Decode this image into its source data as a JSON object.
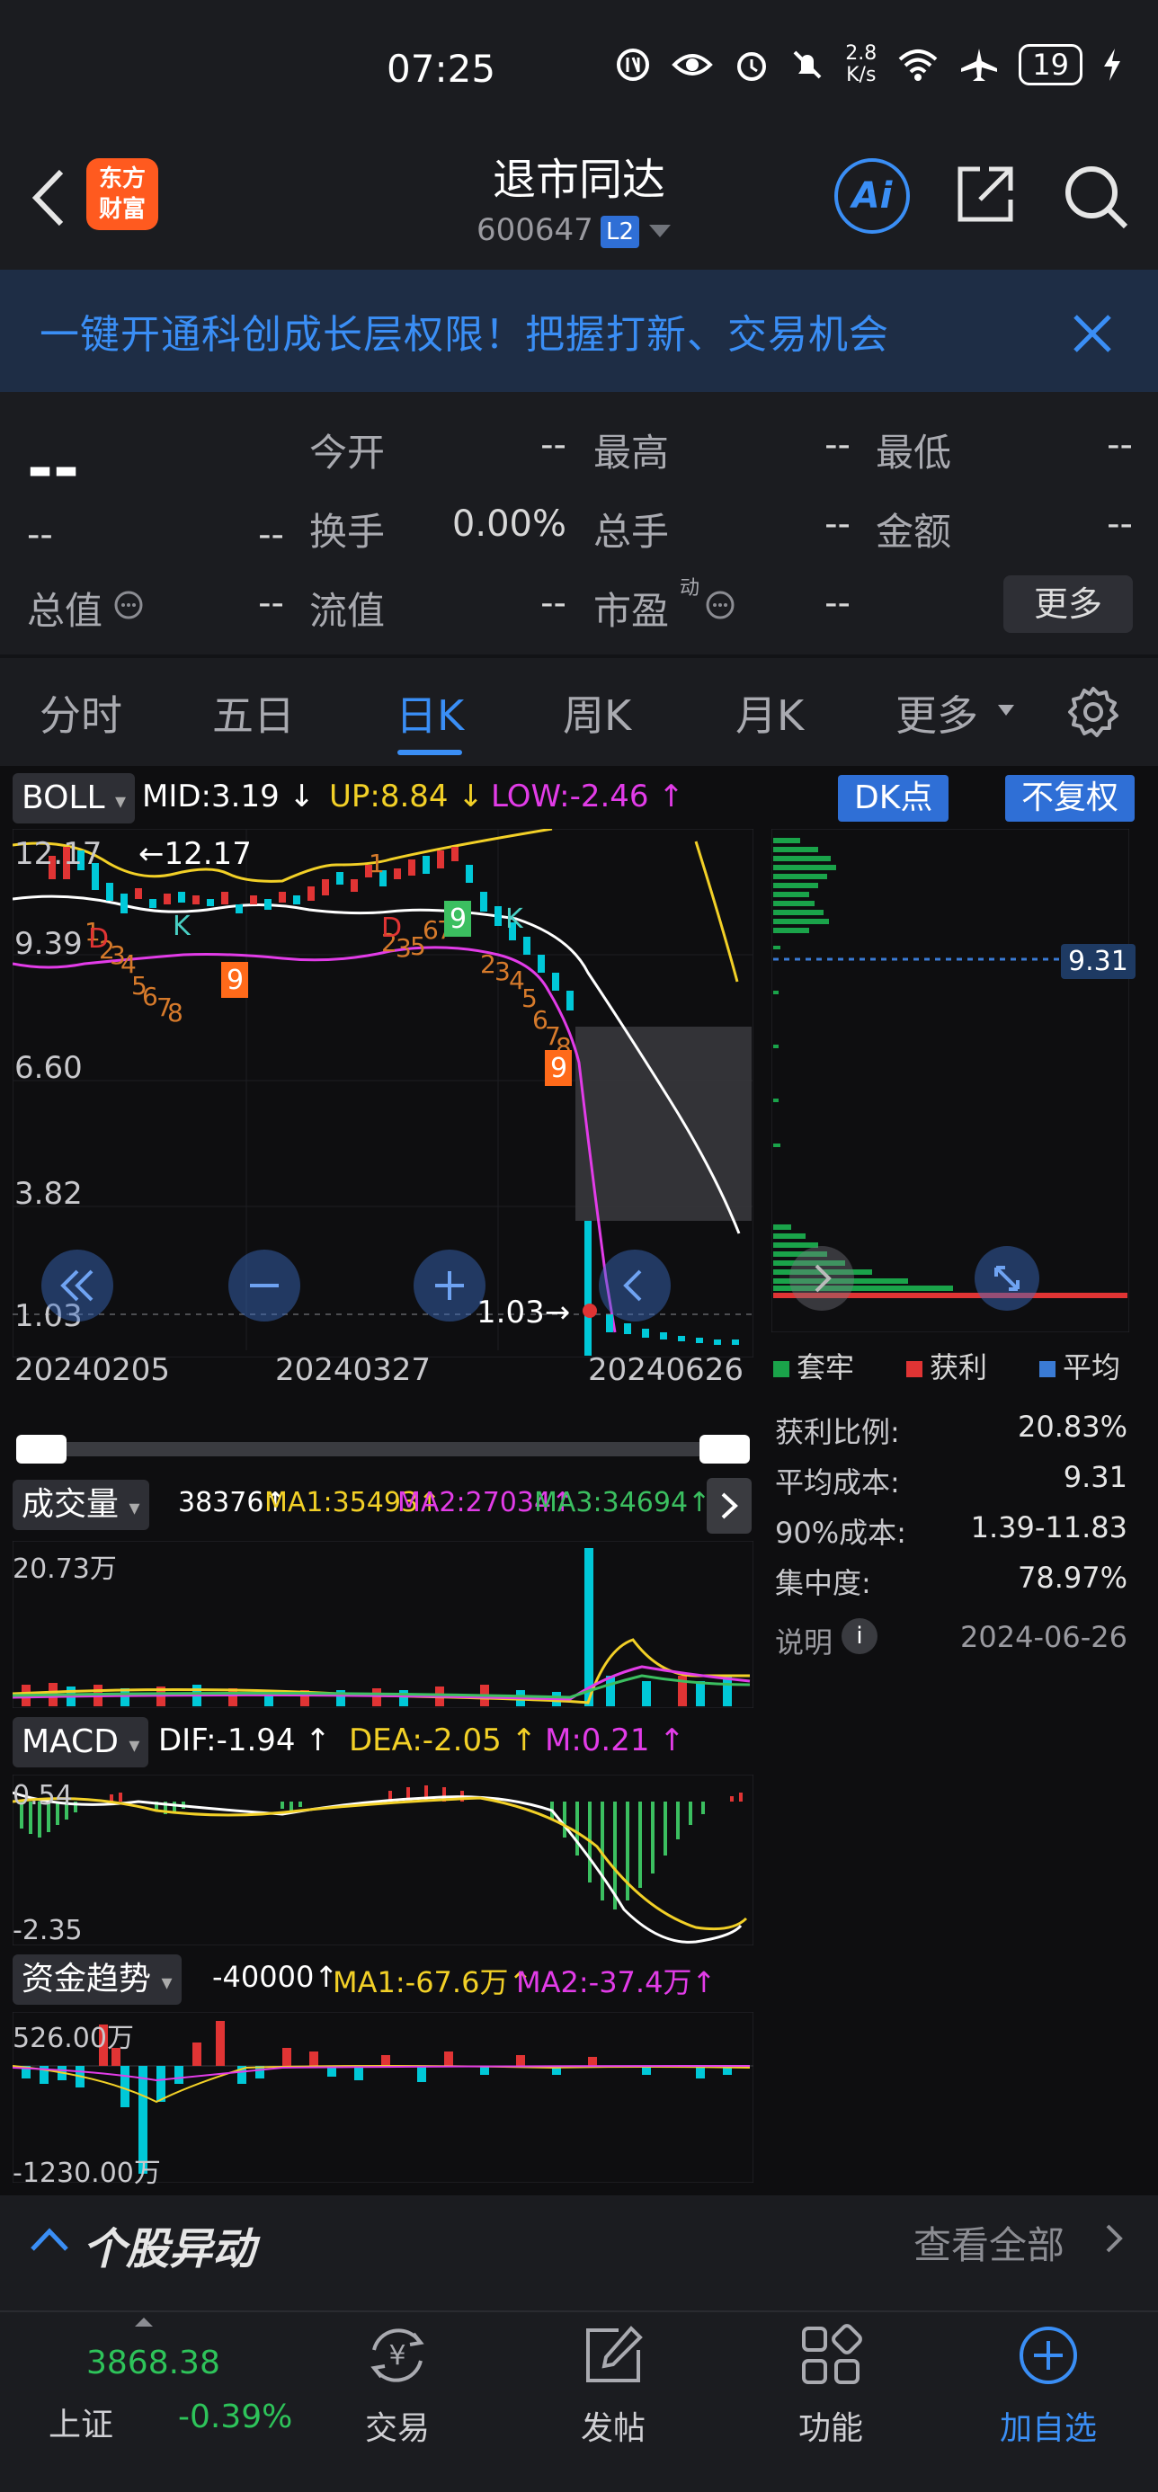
{
  "status": {
    "time": "07:25",
    "net_speed_top": "2.8",
    "net_speed_bottom": "K/s",
    "battery": "19"
  },
  "header": {
    "title": "退市同达",
    "code": "600647",
    "level_badge": "L2",
    "logo_text_top": "东方",
    "logo_text_bottom": "财富",
    "ai_label": "Ai"
  },
  "banner": {
    "text": "一键开通科创成长层权限！把握打新、交易机会"
  },
  "quote": {
    "price": "--",
    "change": "--",
    "change_pct": "--",
    "fields": [
      {
        "label": "今开",
        "value": "--"
      },
      {
        "label": "最高",
        "value": "--"
      },
      {
        "label": "最低",
        "value": "--"
      },
      {
        "label": "换手",
        "value": "0.00%"
      },
      {
        "label": "总手",
        "value": "--"
      },
      {
        "label": "金额",
        "value": "--"
      },
      {
        "label": "总值",
        "value": "--"
      },
      {
        "label": "流值",
        "value": "--"
      },
      {
        "label": "市盈",
        "value": "--"
      }
    ],
    "pe_superscript": "动",
    "more_label": "更多"
  },
  "tabs": [
    {
      "label": "分时",
      "active": false
    },
    {
      "label": "五日",
      "active": false
    },
    {
      "label": "日K",
      "active": true
    },
    {
      "label": "周K",
      "active": false
    },
    {
      "label": "月K",
      "active": false
    },
    {
      "label": "更多",
      "active": false
    }
  ],
  "boll": {
    "name": "BOLL",
    "mid": "MID:3.19",
    "up": "UP:8.84",
    "low": "LOW:-2.46",
    "dk_label": "DK点",
    "adjust_label": "不复权"
  },
  "kline": {
    "price_labels": [
      "12.17",
      "9.39",
      "6.60",
      "3.82",
      "1.03"
    ],
    "max_marker": "←12.17",
    "min_marker": "1.03→",
    "dates": [
      "20240205",
      "20240327",
      "20240626"
    ],
    "cost_line": "9.31",
    "sequence_marks": [
      "1",
      "2",
      "3",
      "4",
      "5",
      "6",
      "7",
      "8",
      "9"
    ]
  },
  "chip": {
    "legend": [
      "套牢",
      "获利",
      "平均"
    ],
    "legend_colors": [
      "#1aa34a",
      "#e03434",
      "#3a7bd5"
    ],
    "stats": [
      {
        "label": "获利比例:",
        "value": "20.83%"
      },
      {
        "label": "平均成本:",
        "value": "9.31"
      },
      {
        "label": "90%成本:",
        "value": "1.39-11.83"
      },
      {
        "label": "集中度:",
        "value": "78.97%"
      }
    ],
    "note_label": "说明",
    "note_date": "2024-06-26"
  },
  "volume": {
    "name": "成交量",
    "value": "38376",
    "ma1": "MA1:35493",
    "ma2": "MA2:27034",
    "ma3": "MA3:34694",
    "axis_top": "20.73万"
  },
  "macd": {
    "name": "MACD",
    "dif": "DIF:-1.94",
    "dea": "DEA:-2.05",
    "m": "M:0.21",
    "axis_top": "0.54",
    "axis_bottom": "-2.35"
  },
  "fund": {
    "name": "资金趋势",
    "value": "-40000",
    "ma1": "MA1:-67.6万",
    "ma2": "MA2:-37.4万",
    "axis_top": "526.00万",
    "axis_bottom": "-1230.00万"
  },
  "movement": {
    "title": "个股异动",
    "view_all": "查看全部"
  },
  "bottom_nav": {
    "index_value": "3868.38",
    "index_name": "上证",
    "index_change": "-0.39%",
    "items": [
      "交易",
      "发帖",
      "功能",
      "加自选"
    ]
  }
}
